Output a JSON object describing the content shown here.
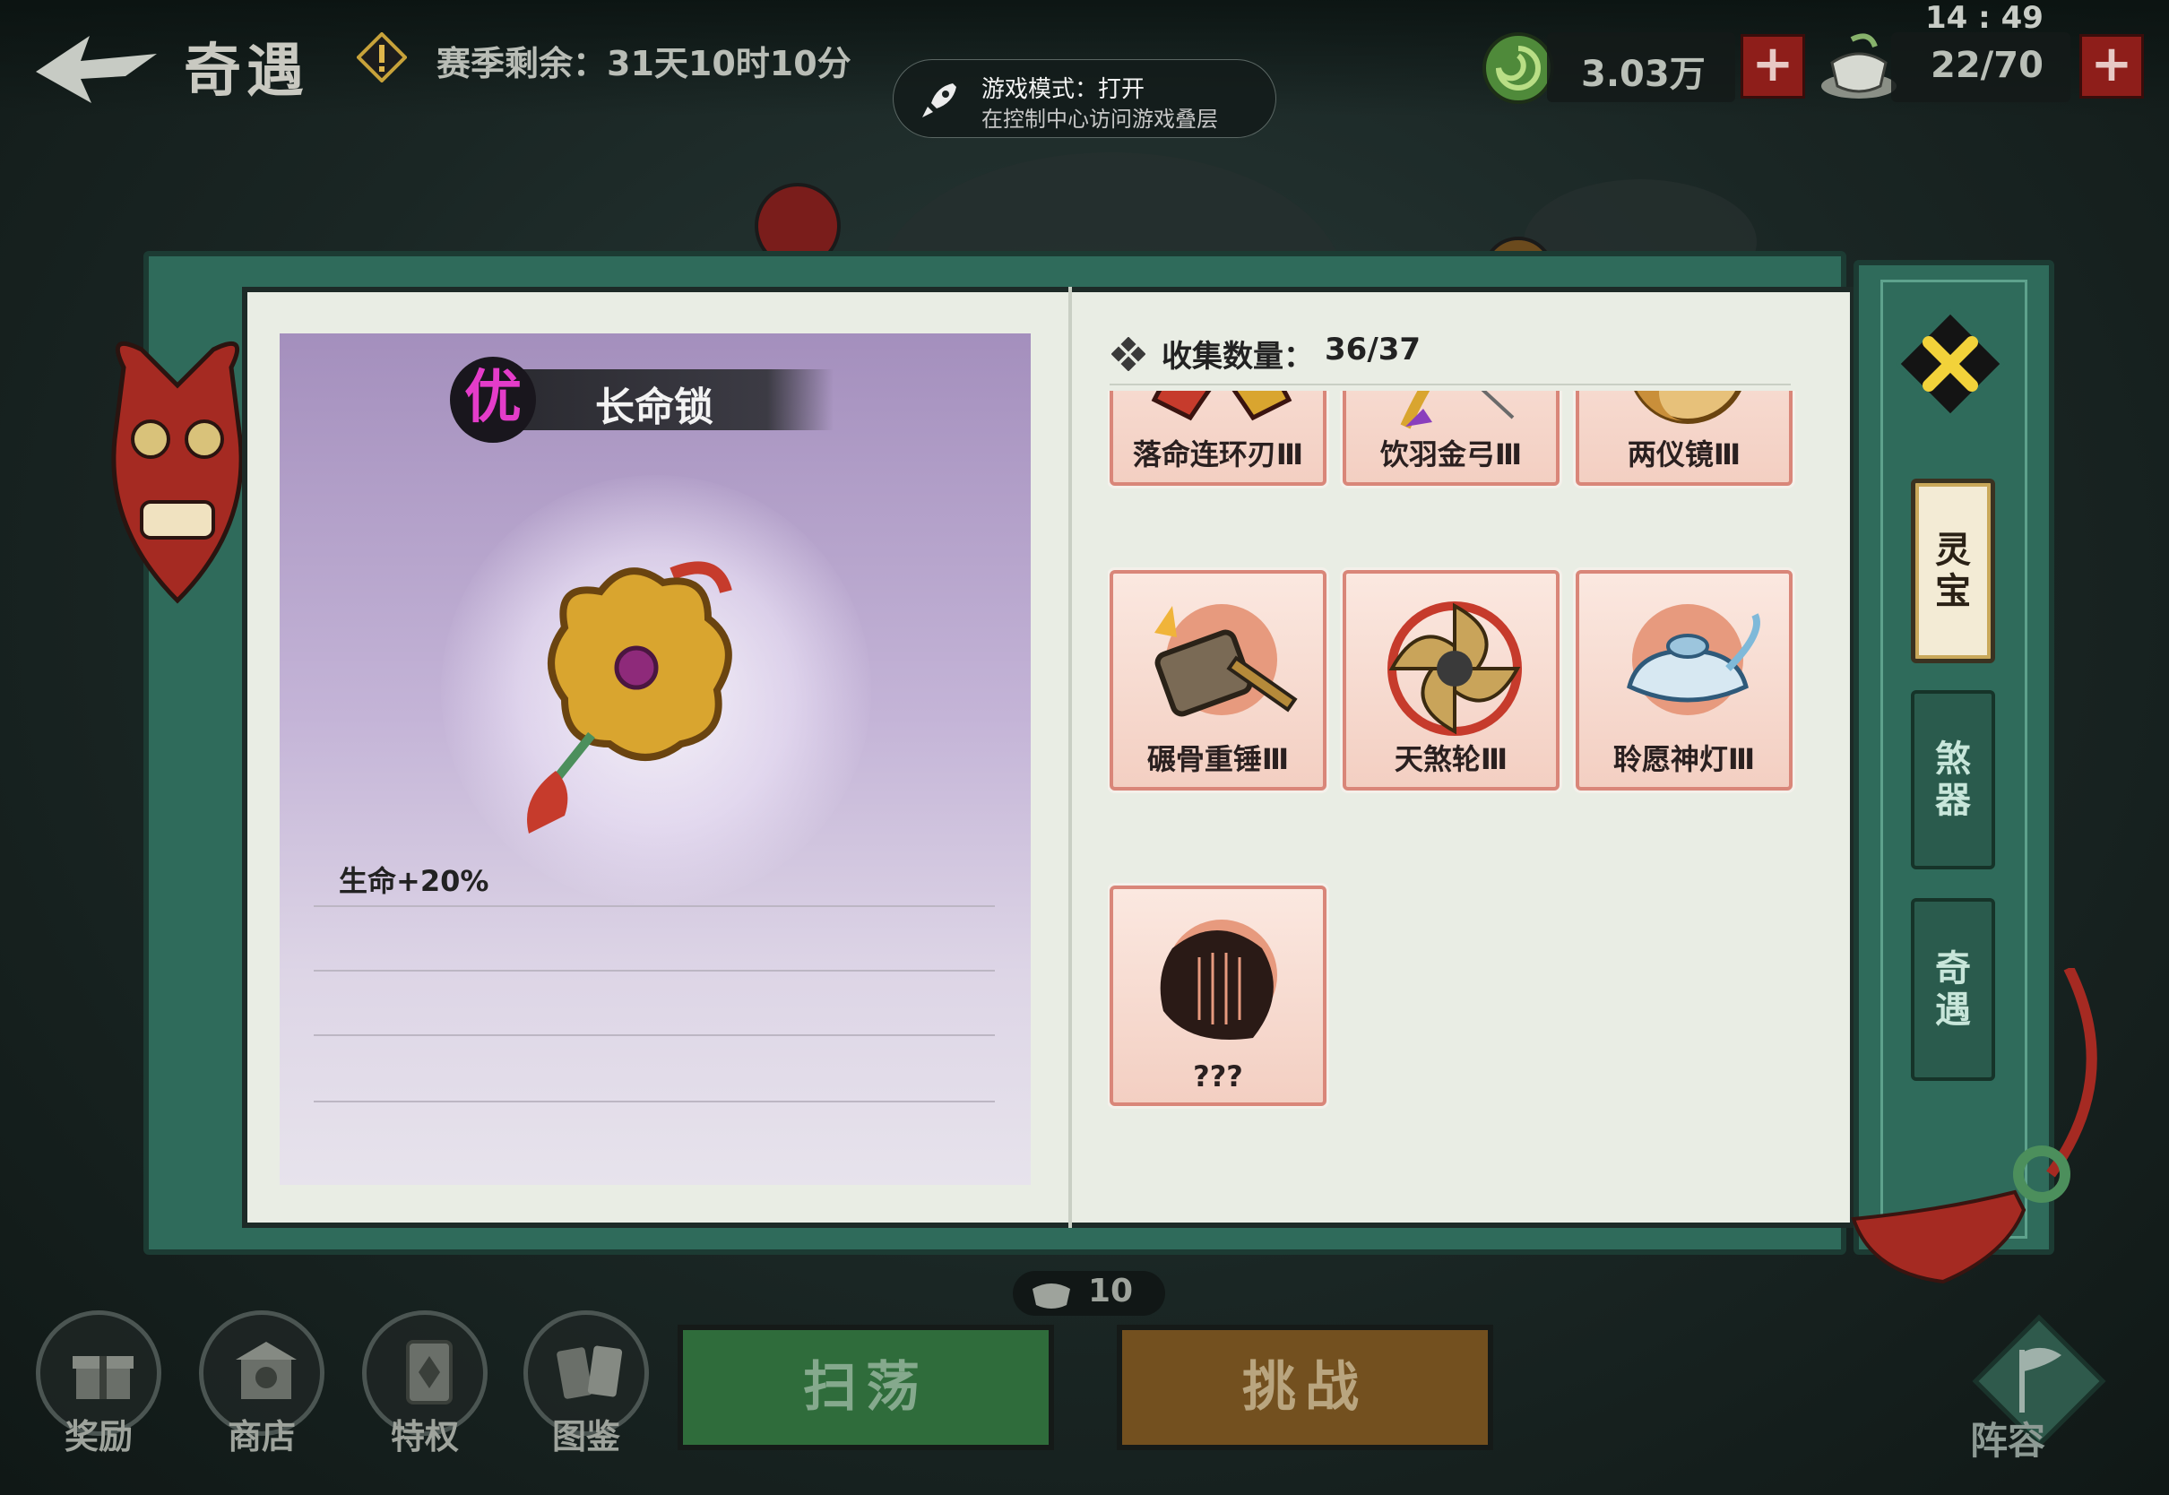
{
  "topbar": {
    "stage_title": "奇遇",
    "season_text": "赛季剩余：31天10时10分",
    "clock": "14 : 49",
    "currency_value": "3.03万",
    "stamina_value": "22/70",
    "plus_label": "+"
  },
  "toast": {
    "title": "游戏模式：打开",
    "subtitle": "在控制中心访问游戏叠层"
  },
  "detail": {
    "grade": "优",
    "item_name": "长命锁",
    "stat": "生命+20%",
    "grade_color": "#e43cc9"
  },
  "collection": {
    "label": "收集数量：",
    "count": "36/37",
    "items": [
      {
        "label": "落命连环刃Ⅲ",
        "icon": "twin-blade-icon"
      },
      {
        "label": "饮羽金弓Ⅲ",
        "icon": "golden-bow-icon"
      },
      {
        "label": "两仪镜Ⅲ",
        "icon": "taiji-mirror-icon"
      },
      {
        "label": "碾骨重锤Ⅲ",
        "icon": "war-hammer-icon"
      },
      {
        "label": "天煞轮Ⅲ",
        "icon": "spinning-wheel-blade-icon"
      },
      {
        "label": "聆愿神灯Ⅲ",
        "icon": "magic-lamp-icon"
      },
      {
        "label": "???",
        "icon": "locked-harp-silhouette-icon"
      }
    ]
  },
  "side_tabs": [
    {
      "label": "灵宝",
      "active": true
    },
    {
      "label": "煞器",
      "active": false
    },
    {
      "label": "奇遇",
      "active": false
    }
  ],
  "bottom": {
    "buttons": [
      {
        "label": "奖励",
        "icon": "gift-icon"
      },
      {
        "label": "商店",
        "icon": "shop-icon"
      },
      {
        "label": "特权",
        "icon": "privilege-card-icon"
      },
      {
        "label": "图鉴",
        "icon": "codex-cards-icon"
      }
    ],
    "stamina_cost": "10",
    "sweep_label": "扫荡",
    "challenge_label": "挑战",
    "lineup_label": "阵容"
  },
  "colors": {
    "book_green": "#2f6b5b",
    "page": "#e9ede4",
    "tile_border": "#d98679",
    "sweep": "#2f6c3b",
    "challenge": "#73501f",
    "plus_red": "#8e1e1a"
  }
}
